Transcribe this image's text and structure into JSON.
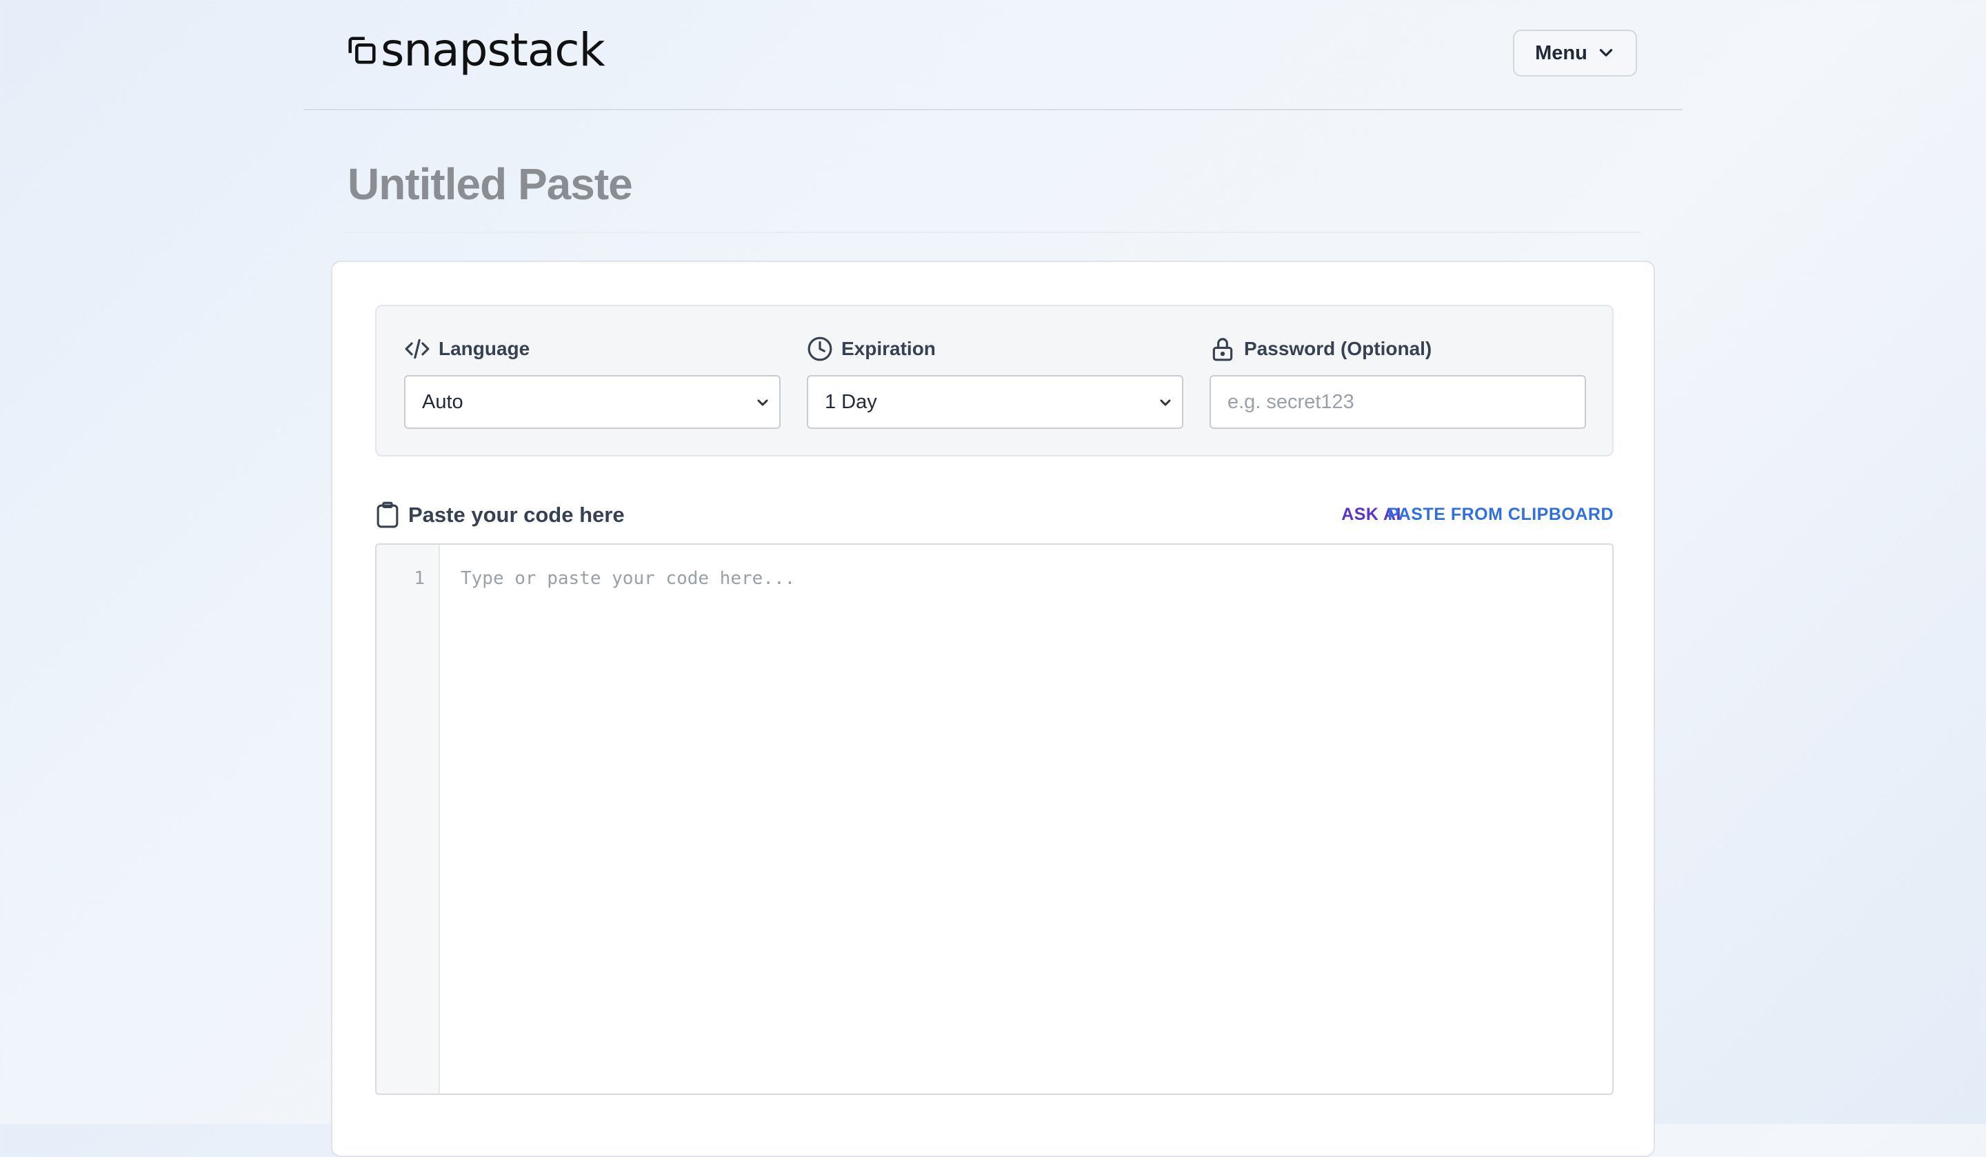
{
  "header": {
    "logo_text": "snapstack",
    "menu_label": "Menu"
  },
  "page": {
    "title": "Untitled Paste"
  },
  "options": {
    "language": {
      "label": "Language",
      "value": "Auto"
    },
    "expiration": {
      "label": "Expiration",
      "value": "1 Day"
    },
    "password": {
      "label": "Password (Optional)",
      "placeholder": "e.g. secret123"
    }
  },
  "editor": {
    "label": "Paste your code here",
    "ask_ai": "ASK AI",
    "paste_from_clipboard": "PASTE FROM CLIPBOARD",
    "line_numbers": [
      "1"
    ],
    "placeholder": "Type or paste your code here..."
  },
  "icons": {
    "logo": "stacked-squares-icon",
    "menu": "chevron-down-icon",
    "language": "code-icon",
    "expiration": "clock-icon",
    "password": "lock-icon",
    "editor": "clipboard-icon"
  }
}
